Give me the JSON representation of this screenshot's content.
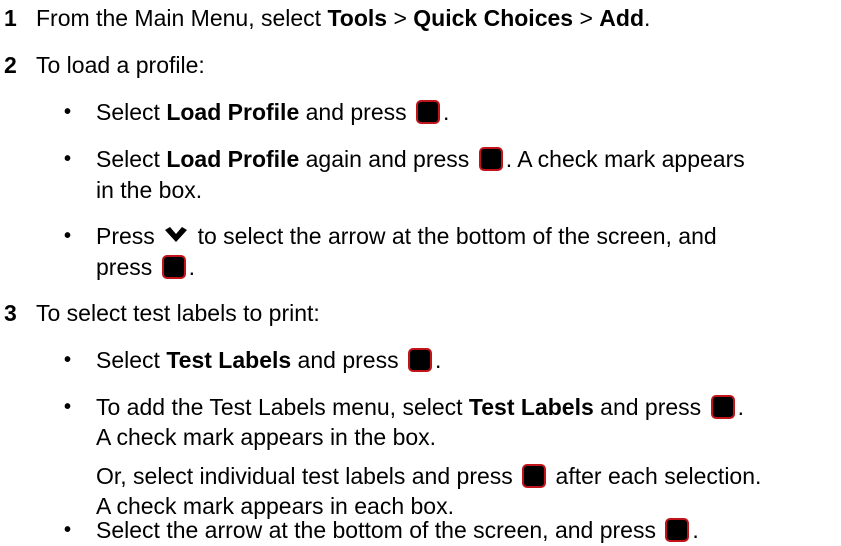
{
  "steps": [
    {
      "number": "1",
      "parts": [
        "From the Main Menu, select ",
        "Tools",
        " > ",
        "Quick Choices",
        " > ",
        "Add",
        "."
      ]
    },
    {
      "number": "2",
      "intro": "To load a profile:",
      "bullets": [
        {
          "pre": "Select ",
          "bold": "Load Profile",
          "post": " and press ",
          "end": "."
        },
        {
          "pre": "Select ",
          "bold": "Load Profile",
          "post": " again and press ",
          "end": ". A check mark appears",
          "cont": "in the box."
        },
        {
          "pre": "Press ",
          "mid": " to select the arrow at the bottom of the screen, and",
          "cont": "press ",
          "end": "."
        }
      ]
    },
    {
      "number": "3",
      "intro": "To select test labels to print:",
      "bullets": [
        {
          "pre": "Select ",
          "bold": "Test Labels",
          "post": " and press ",
          "end": "."
        },
        {
          "pre": "To add the Test Labels menu, select ",
          "bold": "Test Labels",
          "post": " and press ",
          "end": ".",
          "cont": "A check mark appears in the box."
        },
        {
          "para1": "Or, select individual test labels and press ",
          "para1b": " after each selection.",
          "para2": "A check mark appears in each box."
        },
        {
          "pre": "Select the arrow at the bottom of the screen, and press ",
          "end": "."
        }
      ]
    }
  ],
  "bullet_char": "•",
  "icons": {
    "enter_key": "enter-key-icon",
    "down_arrow": "down-chevron-icon"
  },
  "colors": {
    "key_fill": "#000000",
    "key_border": "#c0141a"
  }
}
